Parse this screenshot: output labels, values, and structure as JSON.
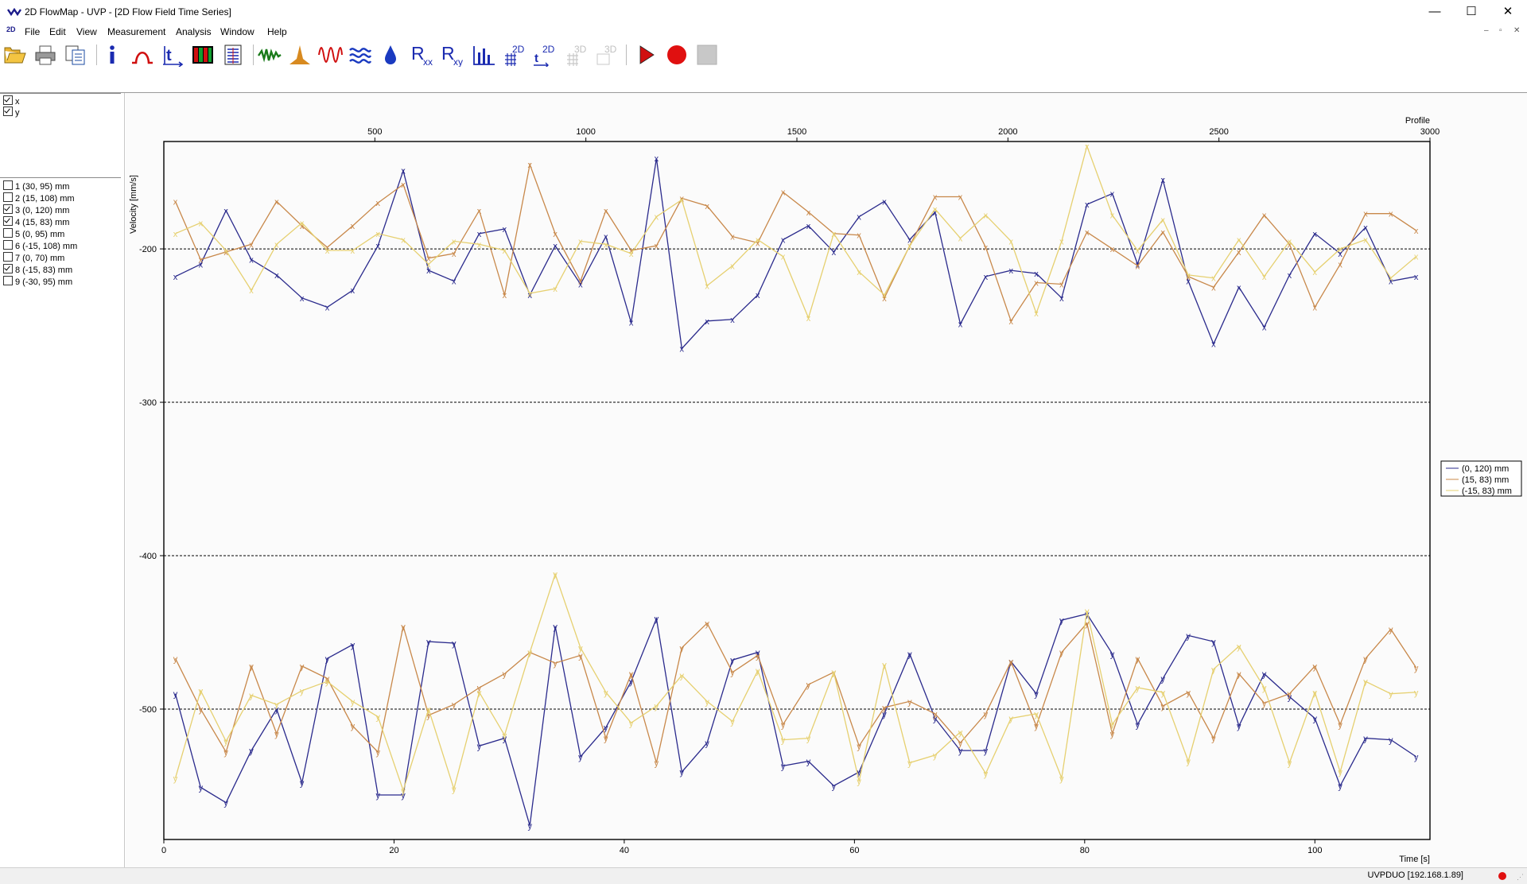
{
  "window": {
    "title": "2D FlowMap - UVP - [2D Flow Field Time Series]",
    "controls": {
      "minimize": "—",
      "maximize": "☐",
      "close": "✕"
    },
    "doc_icon": "2D",
    "mdi_controls": [
      "–",
      "▫",
      "✕"
    ]
  },
  "menu": [
    "File",
    "Edit",
    "View",
    "Measurement",
    "Analysis",
    "Window",
    "Help"
  ],
  "toolbar": [
    {
      "id": "open",
      "icon": "folder-open-icon",
      "enabled": true
    },
    {
      "id": "print",
      "icon": "printer-icon",
      "enabled": true
    },
    {
      "id": "copy",
      "icon": "copy-icon",
      "enabled": true
    },
    {
      "id": "info",
      "icon": "info-icon",
      "enabled": true
    },
    {
      "id": "pulse",
      "icon": "pulse-shape-icon",
      "enabled": true
    },
    {
      "id": "profile-time",
      "icon": "profile-time-icon",
      "enabled": true
    },
    {
      "id": "colormap",
      "icon": "colormap-icon",
      "enabled": true
    },
    {
      "id": "table",
      "icon": "table-icon",
      "enabled": true
    },
    {
      "id": "signal",
      "icon": "signal-icon",
      "enabled": true
    },
    {
      "id": "histogram",
      "icon": "histogram-peak-icon",
      "enabled": true
    },
    {
      "id": "wave",
      "icon": "wave-icon",
      "enabled": true
    },
    {
      "id": "flow",
      "icon": "flow-waves-icon",
      "enabled": true
    },
    {
      "id": "drop",
      "icon": "water-drop-icon",
      "enabled": true
    },
    {
      "id": "rxx",
      "icon": "correlation-rxx-icon",
      "label": "R",
      "sub": "xx",
      "enabled": true
    },
    {
      "id": "rxy",
      "icon": "correlation-rxy-icon",
      "label": "R",
      "sub": "xy",
      "enabled": true
    },
    {
      "id": "bars",
      "icon": "bar-chart-icon",
      "enabled": true
    },
    {
      "id": "grid2d",
      "icon": "grid-2d-icon",
      "label": "2D",
      "enabled": true
    },
    {
      "id": "time2d",
      "icon": "time-series-2d-icon",
      "label": "2D",
      "enabled": true
    },
    {
      "id": "grid3d",
      "icon": "grid-3d-icon",
      "label": "3D",
      "enabled": false
    },
    {
      "id": "view3d",
      "icon": "view-3d-icon",
      "label": "3D",
      "enabled": false
    },
    {
      "id": "play",
      "icon": "play-icon",
      "enabled": true
    },
    {
      "id": "record",
      "icon": "record-icon",
      "enabled": true
    },
    {
      "id": "stop",
      "icon": "stop-icon",
      "enabled": false
    }
  ],
  "colors": {
    "series1": "#2a2a8c",
    "series2": "#c8884a",
    "series3": "#e6d070",
    "record": "#e01010",
    "play": "#d01010"
  },
  "components": [
    {
      "label": "x",
      "checked": true
    },
    {
      "label": "y",
      "checked": true
    }
  ],
  "positions": [
    {
      "label": "1 (30, 95) mm",
      "checked": false
    },
    {
      "label": "2 (15, 108) mm",
      "checked": false
    },
    {
      "label": "3 (0, 120) mm",
      "checked": true
    },
    {
      "label": "4 (15, 83) mm",
      "checked": true
    },
    {
      "label": "5 (0, 95) mm",
      "checked": false
    },
    {
      "label": "6 (-15, 108) mm",
      "checked": false
    },
    {
      "label": "7 (0, 70) mm",
      "checked": false
    },
    {
      "label": "8 (-15, 83) mm",
      "checked": true
    },
    {
      "label": "9 (-30, 95) mm",
      "checked": false
    }
  ],
  "chart_data": {
    "type": "line",
    "ylabel": "Velocity [mm/s]",
    "xlabel": "Time [s]",
    "x2label": "Profile",
    "xlim": [
      0,
      110
    ],
    "ylim": [
      -585,
      -130
    ],
    "x2lim": [
      0,
      3000
    ],
    "xticks": [
      0,
      20,
      40,
      60,
      80,
      100
    ],
    "yticks": [
      -200,
      -300,
      -400,
      -500
    ],
    "x2ticks": [
      500,
      1000,
      1500,
      2000,
      2500,
      3000
    ],
    "grid": "horizontal dashed",
    "legend_position": "right",
    "x": [
      1,
      3.2,
      5.4,
      7.6,
      9.8,
      12,
      14.2,
      16.4,
      18.6,
      20.8,
      23,
      25.2,
      27.4,
      29.6,
      31.8,
      34,
      36.2,
      38.4,
      40.6,
      42.8,
      45,
      47.2,
      49.4,
      51.6,
      53.8,
      56,
      58.2,
      60.4,
      62.6,
      64.8,
      67,
      69.2,
      71.4,
      73.6,
      75.8,
      78,
      80.2,
      82.4,
      84.6,
      86.8,
      89,
      91.2,
      93.4,
      95.6,
      97.8,
      100,
      102.2,
      104.4,
      106.6,
      108.8
    ],
    "series": [
      {
        "name": "(0, 120) mm",
        "color_key": "series1",
        "point_label": "x",
        "values": [
          -218,
          -210,
          -175,
          -207,
          -217,
          -232,
          -238,
          -227,
          -198,
          -149,
          -214,
          -221,
          -190,
          -187,
          -230,
          -198,
          -223,
          -192,
          -248,
          -141,
          -265,
          -247,
          -246,
          -230,
          -194,
          -185,
          -202,
          -179,
          -169,
          -194,
          -176,
          -249,
          -218,
          -214,
          -216,
          -232,
          -171,
          -164,
          -210,
          -155,
          -221,
          -262,
          -225,
          -251,
          -217,
          -190,
          -203,
          -186,
          -221,
          -218
        ]
      },
      {
        "name": "(15, 83) mm",
        "color_key": "series2",
        "point_label": "x",
        "values": [
          -169,
          -207,
          -202,
          -197,
          -169,
          -185,
          -199,
          -185,
          -170,
          -158,
          -206,
          -203,
          -175,
          -230,
          -145,
          -190,
          -221,
          -175,
          -201,
          -198,
          -167,
          -172,
          -192,
          -196,
          -163,
          -176,
          -190,
          -191,
          -232,
          -198,
          -166,
          -166,
          -199,
          -247,
          -222,
          -223,
          -189,
          -200,
          -211,
          -189,
          -218,
          -225,
          -202,
          -178,
          -197,
          -238,
          -210,
          -177,
          -177,
          -188
        ]
      },
      {
        "name": "(-15, 83) mm",
        "color_key": "series3",
        "point_label": "x",
        "values": [
          -190,
          -183,
          -201,
          -227,
          -197,
          -183,
          -201,
          -201,
          -190,
          -194,
          -210,
          -195,
          -197,
          -201,
          -229,
          -226,
          -195,
          -197,
          -203,
          -179,
          -168,
          -224,
          -211,
          -194,
          -205,
          -245,
          -190,
          -215,
          -230,
          -198,
          -174,
          -193,
          -178,
          -195,
          -242,
          -195,
          -133,
          -178,
          -201,
          -181,
          -217,
          -219,
          -194,
          -218,
          -195,
          -215,
          -200,
          -194,
          -219,
          -205
        ]
      },
      {
        "name": "(0, 120) mm",
        "color_key": "series1",
        "point_label": "y",
        "values": [
          -490,
          -551,
          -561,
          -527,
          -500,
          -548,
          -467,
          -458,
          -556,
          -556,
          -456,
          -457,
          -524,
          -519,
          -576,
          -446,
          -531,
          -512,
          -482,
          -441,
          -541,
          -522,
          -468,
          -463,
          -537,
          -534,
          -550,
          -541,
          -503,
          -464,
          -506,
          -527,
          -527,
          -469,
          -490,
          -442,
          -438,
          -464,
          -510,
          -480,
          -452,
          -456,
          -511,
          -477,
          -492,
          -506,
          -550,
          -519,
          -520,
          -531
        ]
      },
      {
        "name": "(15, 83) mm",
        "color_key": "series2",
        "point_label": "y",
        "values": [
          -467,
          -500,
          -528,
          -472,
          -516,
          -472,
          -480,
          -511,
          -528,
          -446,
          -504,
          -497,
          -486,
          -477,
          -463,
          -470,
          -465,
          -519,
          -477,
          -535,
          -460,
          -444,
          -476,
          -465,
          -510,
          -484,
          -476,
          -524,
          -499,
          -495,
          -503,
          -522,
          -503,
          -469,
          -511,
          -463,
          -444,
          -516,
          -467,
          -498,
          -489,
          -519,
          -477,
          -496,
          -490,
          -472,
          -510,
          -467,
          -448,
          -473
        ]
      },
      {
        "name": "(-15, 83) mm",
        "color_key": "series3",
        "point_label": "y",
        "values": [
          -545,
          -488,
          -521,
          -491,
          -497,
          -488,
          -482,
          -495,
          -505,
          -553,
          -500,
          -552,
          -489,
          -517,
          -463,
          -412,
          -460,
          -489,
          -509,
          -498,
          -478,
          -495,
          -508,
          -475,
          -520,
          -519,
          -476,
          -547,
          -471,
          -535,
          -530,
          -515,
          -542,
          -506,
          -503,
          -545,
          -436,
          -510,
          -486,
          -489,
          -534,
          -474,
          -459,
          -486,
          -535,
          -489,
          -541,
          -482,
          -490,
          -489
        ]
      }
    ]
  },
  "status": {
    "device": "UVPDUO [192.168.1.89]"
  }
}
